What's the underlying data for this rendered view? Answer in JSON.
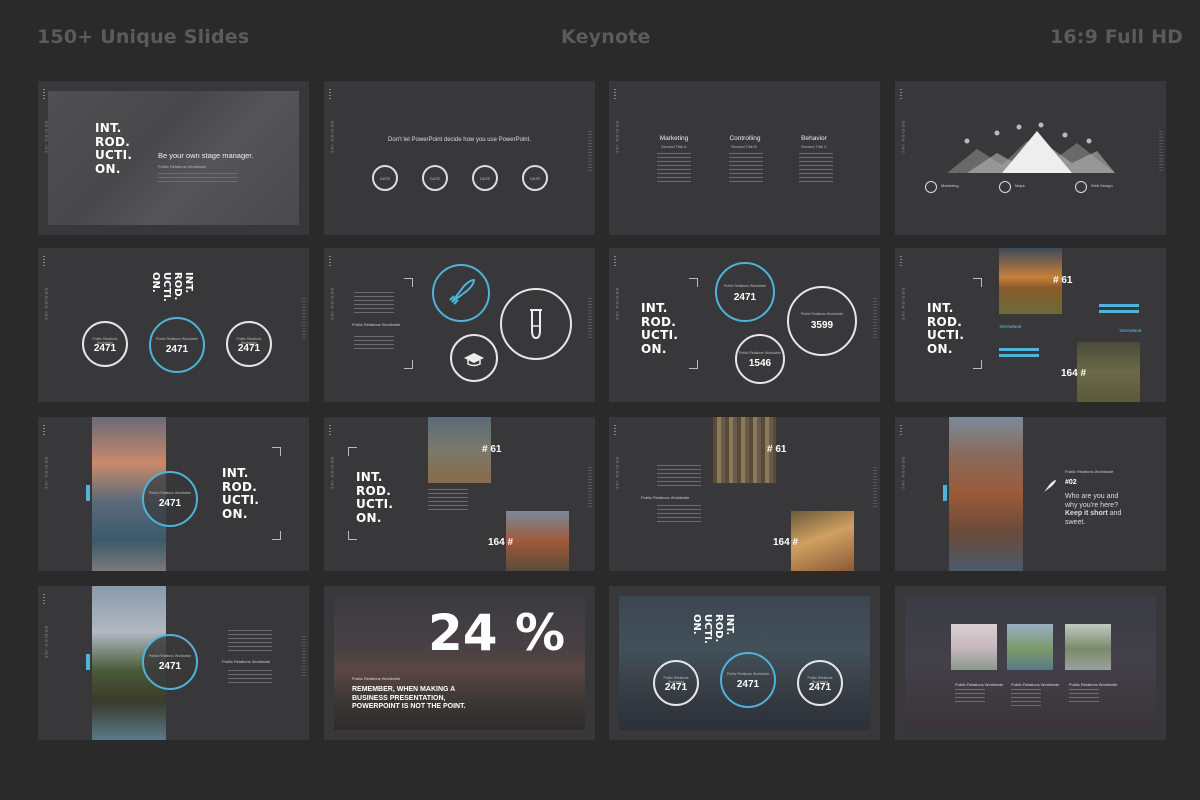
{
  "header": {
    "left": "150+ Unique Slides",
    "center": "Keynote",
    "right": "16:9 Full HD"
  },
  "common": {
    "side_label": "DESIGN INC.",
    "intro": "INT.\nROD.\nUCTI.\nON.",
    "stat_caption": "Public Relations Worldwide"
  },
  "slides": {
    "s1": {
      "heading": "Be your own stage manager.",
      "sub": "Public Relations Worldwide"
    },
    "s2": {
      "heading": "Don't let PowerPoint decide how you use PowerPoint.",
      "rings": [
        "DATE",
        "DATE",
        "DATE",
        "DATE"
      ]
    },
    "s3": {
      "cols": [
        {
          "title": "Marketing",
          "sub": "Second Title A"
        },
        {
          "title": "Controlling",
          "sub": "Second Title B"
        },
        {
          "title": "Behavior",
          "sub": "Second Title C"
        }
      ]
    },
    "s4": {
      "items": [
        "Marketing",
        "Maps",
        "Web Design"
      ]
    },
    "s5": {
      "values": [
        "2471",
        "2471",
        "2471"
      ]
    },
    "s6": {
      "caption": "Public Relations Worldwide"
    },
    "s7": {
      "values": [
        "2471",
        "3599",
        "1546"
      ]
    },
    "s8": {
      "tag1": "# 61",
      "tag2": "164 #",
      "label1": "TESTDRIVE",
      "label2": "TESTDRIVE"
    },
    "s9": {
      "value": "2471"
    },
    "s10": {
      "tag1": "# 61",
      "tag2": "164 #"
    },
    "s11": {
      "tag1": "# 61",
      "tag2": "164 #",
      "caption": "Public Relations Worldwide"
    },
    "s12": {
      "num": "#02",
      "line1": "Who are you and",
      "line2": "why you're here?",
      "line3": "Keep it short",
      "line3b": " and",
      "line4": "sweet.",
      "caption": "Public Relations Worldwide"
    },
    "s13": {
      "value": "2471",
      "caption": "Public Relations Worldwide"
    },
    "s14": {
      "percent": "24 %",
      "caption": "Public Relations Worldwide",
      "quote1": "REMEMBER, WHEN MAKING A",
      "quote2": "BUSINESS PRESENTATION,",
      "quote3": "POWERPOINT IS NOT THE POINT."
    },
    "s15": {
      "values": [
        "2471",
        "2471",
        "2471"
      ]
    },
    "s16": {
      "captions": [
        "Public Relations Worldwide",
        "Public Relations Worldwide",
        "Public Relations Worldwide"
      ]
    }
  },
  "colors": {
    "accent": "#4fb3d9",
    "background": "#2a2a2b",
    "slide": "#38383a"
  }
}
